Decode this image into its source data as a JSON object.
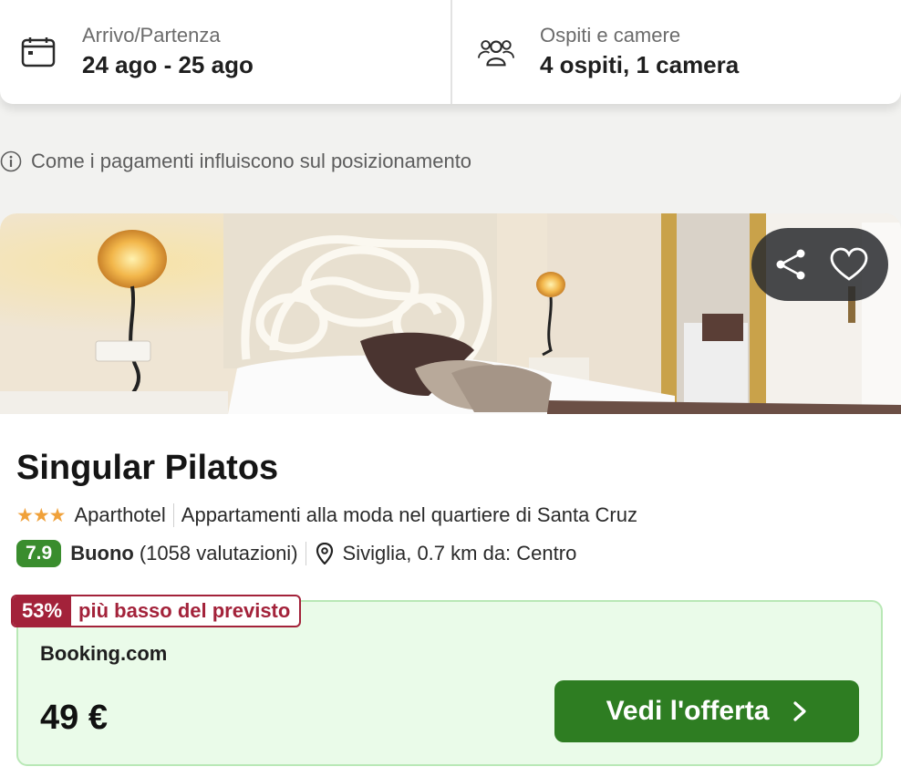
{
  "search": {
    "dates_label": "Arrivo/Partenza",
    "dates_value": "24 ago - 25 ago",
    "guests_label": "Ospiti e camere",
    "guests_value": "4 ospiti, 1 camera"
  },
  "info": {
    "text": "Come i pagamenti influiscono sul posizionamento"
  },
  "hotel": {
    "name": "Singular Pilatos",
    "stars": "★★★",
    "star_rating": 3,
    "type": "Aparthotel",
    "tagline": "Appartamenti alla moda nel quartiere di Santa Cruz",
    "rating_score": "7.9",
    "rating_word": "Buono",
    "rating_count": "(1058 valutazioni)",
    "location": "Siviglia, 0.7 km da: Centro"
  },
  "deal": {
    "percent": "53%",
    "label": "più basso del previsto",
    "provider": "Booking.com",
    "price": "49 €",
    "cta": "Vedi l'offerta"
  },
  "colors": {
    "rating_green": "#3a8d2e",
    "cta_green": "#2e7d22",
    "deal_red": "#a3223a",
    "star_orange": "#f0a13a",
    "deal_bg": "#eafbe9"
  },
  "icons": [
    "calendar-icon",
    "guests-icon",
    "info-icon",
    "share-icon",
    "heart-icon",
    "map-pin-icon",
    "chevron-right-icon"
  ]
}
